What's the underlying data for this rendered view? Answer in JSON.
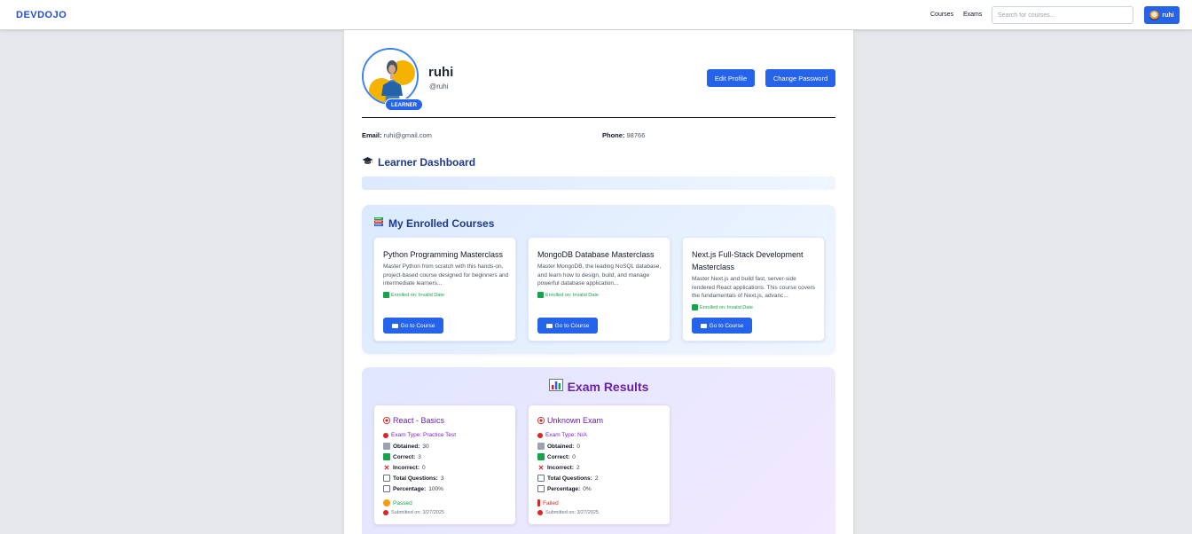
{
  "navbar": {
    "brand": "DEVDOJO",
    "links": [
      "Courses",
      "Exams"
    ],
    "search_placeholder": "Search for courses...",
    "user_label": "ruhi"
  },
  "profile": {
    "name": "ruhi",
    "handle": "@ruhi",
    "role": "LEARNER",
    "edit_label": "Edit Profile",
    "change_password_label": "Change Password",
    "email_label": "Email:",
    "email": "ruhi@gmail.com",
    "phone_label": "Phone:",
    "phone": "98766"
  },
  "dashboard": {
    "title": "Learner Dashboard"
  },
  "enrolled": {
    "title": "My Enrolled Courses",
    "go_label": "Go to Course",
    "courses": [
      {
        "title": "Python Programming Masterclass",
        "description": "Master Python from scratch with this hands-on, project-based course designed for beginners and intermediate learners...",
        "enrolled": "Enrolled on: Invalid Date"
      },
      {
        "title": "MongoDB Database Masterclass",
        "description": "Master MongoDB, the leading NoSQL database, and learn how to design, build, and manage powerful database application...",
        "enrolled": "Enrolled on: Invalid Date"
      },
      {
        "title": "Next.js Full-Stack Development Masterclass",
        "description": "Master Next.js and build fast, server-side rendered React applications. This course covers the fundamentals of Next.js, advanc...",
        "enrolled": "Enrolled on: Invalid Date"
      }
    ]
  },
  "exams": {
    "title": "Exam Results",
    "labels": {
      "obtained": "Obtained:",
      "correct": "Correct:",
      "incorrect": "Incorrect:",
      "total": "Total Questions:",
      "percentage": "Percentage:"
    },
    "results": [
      {
        "title": "React - Basics",
        "type": "Exam Type: Practice Test",
        "obtained": "30",
        "correct": "3",
        "incorrect": "0",
        "total": "3",
        "percentage": "100%",
        "status": "Passed",
        "submitted": "Submitted on: 3/27/2025"
      },
      {
        "title": "Unknown Exam",
        "type": "Exam Type: N/A",
        "obtained": "0",
        "correct": "0",
        "incorrect": "2",
        "total": "2",
        "percentage": "0%",
        "status": "Failed",
        "submitted": "Submitted on: 3/27/2025"
      }
    ]
  },
  "colors": {
    "accent": "#2563eb",
    "heading_blue": "#1e3a8a",
    "heading_purple": "#6b21a8",
    "success": "#16a34a",
    "danger": "#dc2626"
  }
}
